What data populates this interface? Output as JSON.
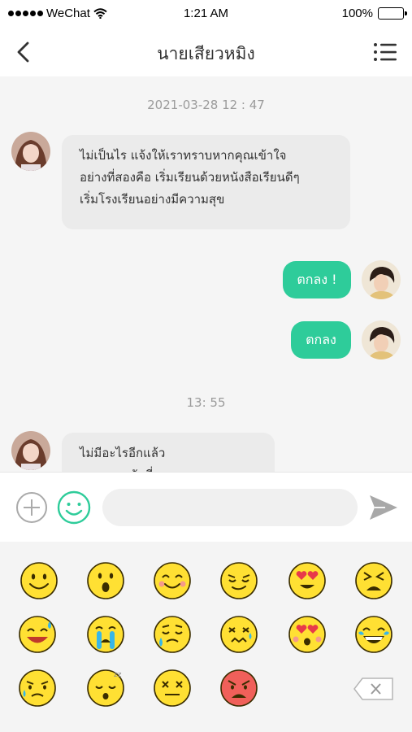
{
  "status_bar": {
    "carrier": "WeChat",
    "time": "1:21 AM",
    "battery": "100%"
  },
  "header": {
    "title": "นายเสียวหมิง"
  },
  "chat": {
    "messages": [
      {
        "type": "timestamp",
        "text": "2021-03-28  12 : 47"
      },
      {
        "type": "received",
        "lines": [
          "ไม่เป็นไร แจ้งให้เราทราบหากคุณเข้าใจ",
          "อย่างที่สองคือ เริ่มเรียนด้วยหนังสือเรียนดีๆ",
          "เริ่มโรงเรียนอย่างมีความสุข"
        ]
      },
      {
        "type": "sent",
        "text": "ตกลง !"
      },
      {
        "type": "sent",
        "text": "ตกลง"
      },
      {
        "type": "timestamp",
        "text": "13:  55"
      },
      {
        "type": "received",
        "lines": [
          "ไม่มีอะไรอีกแล้ว",
          "ขอบคุณครับที่สอน"
        ]
      }
    ]
  },
  "input": {
    "placeholder": ""
  },
  "emoji_panel": {
    "emojis": [
      "smile",
      "surprised",
      "blush",
      "smug",
      "heart-eyes",
      "persevere",
      "sweat-smile",
      "crying",
      "disappointed-relieved",
      "confounded",
      "heart-eyes-blush",
      "joy",
      "sad-sweat",
      "sleeping",
      "dizzy-face",
      "angry"
    ]
  },
  "colors": {
    "accent": "#2ecc9a",
    "emoji_yellow": "#ffe033",
    "angry_red": "#f0605a"
  }
}
